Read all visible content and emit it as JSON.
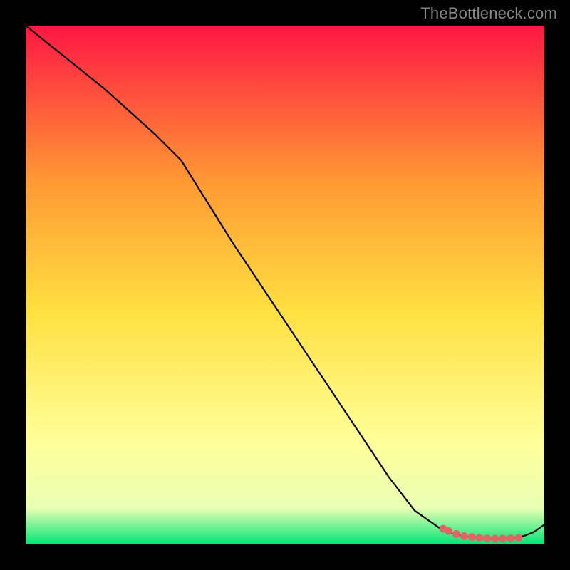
{
  "watermark": "TheBottleneck.com",
  "chart_data": {
    "type": "line",
    "title": "",
    "xlabel": "",
    "ylabel": "",
    "xlim": [
      0,
      100
    ],
    "ylim": [
      0,
      100
    ],
    "background_gradient": {
      "top": "#ff1744",
      "upper_mid": "#ff9933",
      "mid": "#ffe040",
      "lower_mid": "#ffff99",
      "green_band_top": "#e9ffb3",
      "green_band_bottom": "#00e676"
    },
    "series": [
      {
        "name": "curve",
        "type": "line",
        "color": "#000000",
        "x": [
          0,
          5,
          10,
          15,
          20,
          25,
          30,
          35,
          40,
          45,
          50,
          55,
          60,
          65,
          70,
          75,
          80,
          82,
          84,
          86,
          88,
          90,
          92,
          94,
          96,
          98,
          100
        ],
        "y": [
          100,
          96,
          92,
          88,
          83.5,
          79,
          74,
          66,
          58,
          50.5,
          43,
          35.5,
          28,
          20.5,
          13,
          6.5,
          3.0,
          2.2,
          1.7,
          1.4,
          1.2,
          1.1,
          1.1,
          1.2,
          1.6,
          2.4,
          3.8
        ]
      },
      {
        "name": "valley-markers",
        "type": "scatter",
        "color": "#e06666",
        "x": [
          80.5,
          81.5,
          83,
          84.5,
          86,
          87.5,
          89,
          90.5,
          92,
          93.5,
          95
        ],
        "y": [
          3.0,
          2.6,
          2.0,
          1.6,
          1.4,
          1.25,
          1.15,
          1.1,
          1.1,
          1.15,
          1.25
        ]
      }
    ]
  }
}
